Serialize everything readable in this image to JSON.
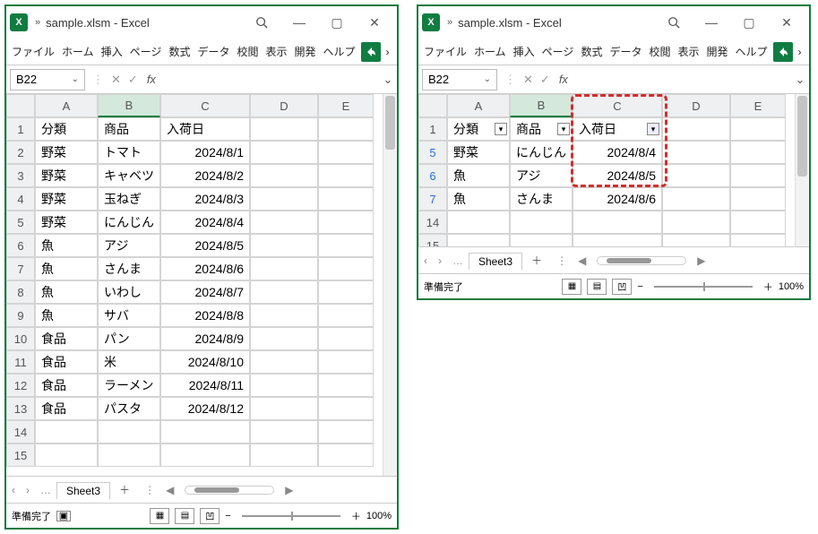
{
  "app": {
    "icon_letter": "X",
    "title_chev": "»",
    "title": "sample.xlsm - Excel"
  },
  "ribbon": [
    "ファイル",
    "ホーム",
    "挿入",
    "ページ",
    "数式",
    "データ",
    "校閲",
    "表示",
    "開発",
    "ヘルプ"
  ],
  "namebox": {
    "value": "B22",
    "fx_label": "fx",
    "divider": ":"
  },
  "cols": [
    "A",
    "B",
    "C",
    "D",
    "E"
  ],
  "left": {
    "rows": [
      "1",
      "2",
      "3",
      "4",
      "5",
      "6",
      "7",
      "8",
      "9",
      "10",
      "11",
      "12",
      "13",
      "14",
      "15"
    ],
    "headers": [
      "分類",
      "商品",
      "入荷日"
    ],
    "data": [
      [
        "野菜",
        "トマト",
        "2024/8/1"
      ],
      [
        "野菜",
        "キャベツ",
        "2024/8/2"
      ],
      [
        "野菜",
        "玉ねぎ",
        "2024/8/3"
      ],
      [
        "野菜",
        "にんじん",
        "2024/8/4"
      ],
      [
        "魚",
        "アジ",
        "2024/8/5"
      ],
      [
        "魚",
        "さんま",
        "2024/8/6"
      ],
      [
        "魚",
        "いわし",
        "2024/8/7"
      ],
      [
        "魚",
        "サバ",
        "2024/8/8"
      ],
      [
        "食品",
        "パン",
        "2024/8/9"
      ],
      [
        "食品",
        "米",
        "2024/8/10"
      ],
      [
        "食品",
        "ラーメン",
        "2024/8/11"
      ],
      [
        "食品",
        "パスタ",
        "2024/8/12"
      ]
    ]
  },
  "right": {
    "rows": [
      "1",
      "5",
      "6",
      "7",
      "14",
      "15"
    ],
    "headers": [
      "分類",
      "商品",
      "入荷日"
    ],
    "data": [
      [
        "野菜",
        "にんじん",
        "2024/8/4"
      ],
      [
        "魚",
        "アジ",
        "2024/8/5"
      ],
      [
        "魚",
        "さんま",
        "2024/8/6"
      ]
    ]
  },
  "sheet": {
    "name": "Sheet3",
    "dots": "…",
    "add": "＋"
  },
  "status": {
    "ready": "準備完了",
    "zoom": "100%",
    "minus": "−",
    "plus": "＋"
  },
  "icons": {
    "filter_down": "▾",
    "filter_active": "⧩",
    "vbar": "⋮",
    "x": "✕",
    "check": "✓",
    "min": "—",
    "max": "▢",
    "close": "✕",
    "chev": "›",
    "left": "‹",
    "right": "›"
  }
}
